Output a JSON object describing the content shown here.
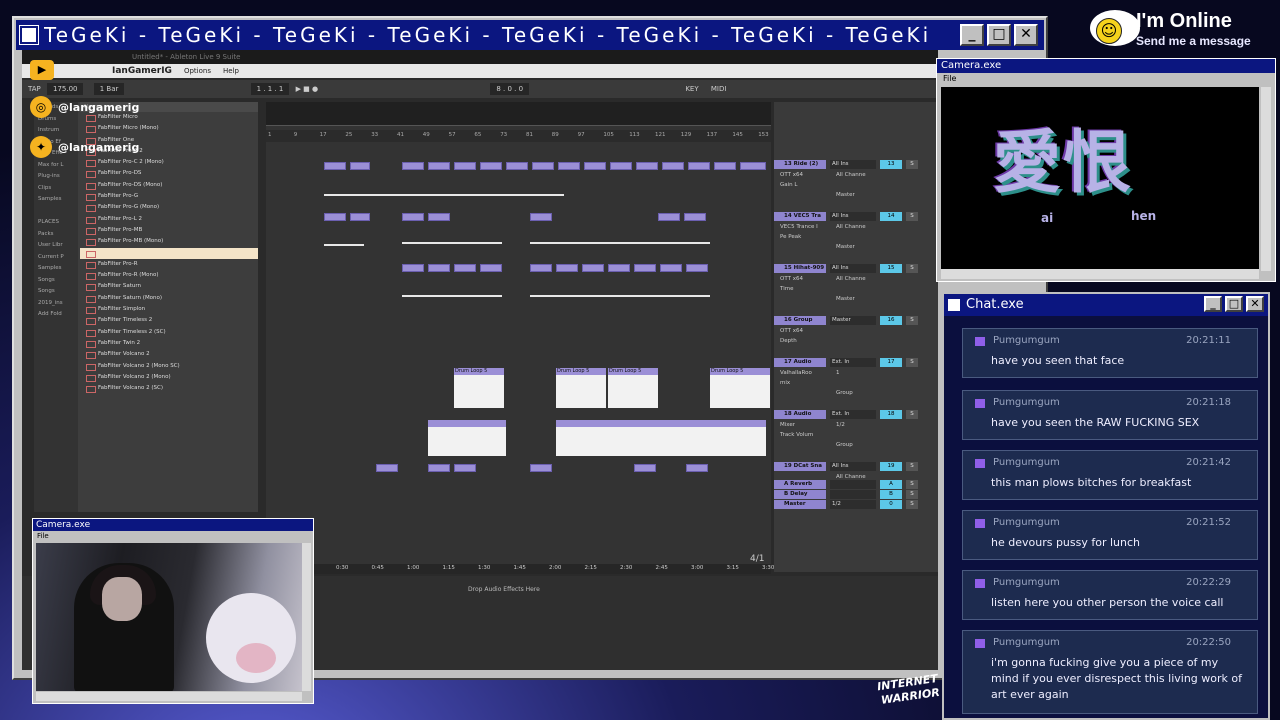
{
  "main_window": {
    "title": "TeGeKi - TeGeKi - TeGeKi - TeGeKi - TeGeKi - TeGeKi - TeGeKi - TeGeKi",
    "min": "_",
    "max": "□",
    "close": "✕"
  },
  "social": {
    "instagram": "@langamerig",
    "twitter": "@langamerig",
    "stream_name": "IanGamerIG"
  },
  "online_badge": {
    "title": "I'm Online",
    "subtitle": "Send me a message"
  },
  "ableton": {
    "window_title": "Untitled* - Ableton Live 9 Suite",
    "menu": [
      "Options",
      "Help"
    ],
    "tempo": "175.00",
    "position": "1 . 1 . 1",
    "loop": "8 . 0 . 0",
    "quant": "1 Bar",
    "places": [
      "Sounds",
      "Drums",
      "Instrum",
      "Audio Ef",
      "MIDI Effe",
      "Max for L",
      "Plug-ins",
      "Clips",
      "Samples",
      "",
      "PLACES",
      "Packs",
      "User Libr",
      "Current P",
      "Samples",
      "Songs",
      "Songs",
      "2019_ins",
      "Add Fold"
    ],
    "browser_header": "Name",
    "browser_items": [
      "FabFilter Micro",
      "FabFilter Micro (Mono)",
      "FabFilter One",
      "FabFilter Pro-C 2",
      "FabFilter Pro-C 2 (Mono)",
      "FabFilter Pro-DS",
      "FabFilter Pro-DS (Mono)",
      "FabFilter Pro-G",
      "FabFilter Pro-G (Mono)",
      "FabFilter Pro-L 2",
      "FabFilter Pro-MB",
      "FabFilter Pro-MB (Mono)",
      "",
      "FabFilter Pro-R",
      "FabFilter Pro-R (Mono)",
      "FabFilter Saturn",
      "FabFilter Saturn (Mono)",
      "FabFilter Simplon",
      "FabFilter Timeless 2",
      "FabFilter Timeless 2 (SC)",
      "FabFilter Twin 2",
      "FabFilter Volcano 2",
      "FabFilter Volcano 2 (Mono SC)",
      "FabFilter Volcano 2 (Mono)",
      "FabFilter Volcano 2 (SC)"
    ],
    "ruler": [
      "1",
      "9",
      "17",
      "25",
      "33",
      "41",
      "49",
      "57",
      "65",
      "73",
      "81",
      "89",
      "97",
      "105",
      "113",
      "121",
      "129",
      "137",
      "145",
      "153"
    ],
    "timebar": [
      "0:30",
      "0:45",
      "1:00",
      "1:15",
      "1:30",
      "1:45",
      "2:00",
      "2:15",
      "2:30",
      "2:45",
      "3:00",
      "3:15",
      "3:30"
    ],
    "clip_label": "Drum Loop 5",
    "page_indicator": "4/1",
    "drop_text": "Drop Audio Effects Here",
    "tracks": [
      {
        "name": "13 Ride (2)",
        "io": "All Ins",
        "io2": "All Channe",
        "dev1": "OTT x64",
        "dev2": "Gain L",
        "num": "13",
        "route": "Master"
      },
      {
        "name": "14 VEC5 Tra",
        "io": "All Ins",
        "io2": "All Channe",
        "dev1": "VEC5 Trance I",
        "dev2": "Pe Peak",
        "num": "14",
        "route": "Master"
      },
      {
        "name": "15 Hihat-909",
        "io": "All Ins",
        "io2": "All Channe",
        "dev1": "OTT x64",
        "dev2": "Time",
        "num": "15",
        "route": "Master"
      },
      {
        "name": "16 Group",
        "io": "Master",
        "io2": "",
        "dev1": "OTT x64",
        "dev2": "Depth",
        "num": "16",
        "route": ""
      },
      {
        "name": "17 Audio",
        "io": "Ext. In",
        "io2": "1",
        "dev1": "ValhallaRoo",
        "dev2": "mix",
        "num": "17",
        "route": "Group"
      },
      {
        "name": "18 Audio",
        "io": "Ext. In",
        "io2": "1/2",
        "dev1": "Mixer",
        "dev2": "Track Volum",
        "num": "18",
        "route": "Group"
      },
      {
        "name": "19 DCat Sna",
        "io": "All Ins",
        "io2": "All Channe",
        "dev1": "",
        "dev2": "",
        "num": "19",
        "route": ""
      },
      {
        "name": "A Reverb",
        "io": "",
        "io2": "",
        "dev1": "",
        "dev2": "",
        "num": "A",
        "route": ""
      },
      {
        "name": "B Delay",
        "io": "",
        "io2": "",
        "dev1": "",
        "dev2": "",
        "num": "B",
        "route": ""
      },
      {
        "name": "Master",
        "io": "1/2",
        "io2": "",
        "dev1": "",
        "dev2": "",
        "num": "0",
        "route": ""
      }
    ]
  },
  "cam_small": {
    "title": "Camera.exe",
    "menu": "File"
  },
  "cam_big": {
    "title": "Camera.exe",
    "menu": "File",
    "kanji": "愛恨",
    "sub1": "ai",
    "sub2": "hen"
  },
  "chat": {
    "title": "Chat.exe",
    "messages": [
      {
        "user": "Pumgumgum",
        "time": "20:21:11",
        "text": "have you seen that face"
      },
      {
        "user": "Pumgumgum",
        "time": "20:21:18",
        "text": "have you seen the RAW FUCKING SEX"
      },
      {
        "user": "Pumgumgum",
        "time": "20:21:42",
        "text": "this man plows bitches for breakfast"
      },
      {
        "user": "Pumgumgum",
        "time": "20:21:52",
        "text": "he devours pussy for lunch"
      },
      {
        "user": "Pumgumgum",
        "time": "20:22:29",
        "text": "listen here you other person the voice call"
      },
      {
        "user": "Pumgumgum",
        "time": "20:22:50",
        "text": "i'm gonna fucking give you a piece of my mind if you ever disrespect this living work of art ever again"
      }
    ]
  },
  "logo": {
    "line1": "INTERNET",
    "line2": "WARRIOR"
  }
}
